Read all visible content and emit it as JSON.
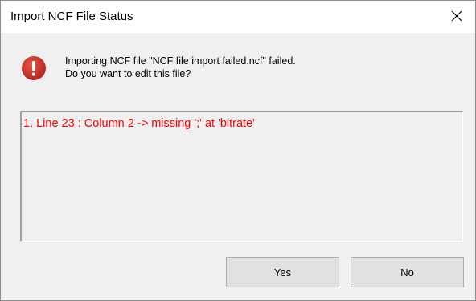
{
  "window": {
    "title": "Import NCF File Status"
  },
  "icons": {
    "close": "close-icon",
    "error": "error-icon"
  },
  "message": {
    "line1": "Importing NCF file \"NCF file import failed.ncf\" failed.",
    "line2": "Do you want to edit this file?"
  },
  "details": {
    "lines": [
      "1. Line 23 : Column 2 -> missing ';' at 'bitrate'"
    ]
  },
  "buttons": {
    "yes_label": "Yes",
    "no_label": "No"
  },
  "colors": {
    "error_text": "#ff0000",
    "error_icon": "#c42b1c",
    "dialog_background": "#f0f0f0"
  }
}
